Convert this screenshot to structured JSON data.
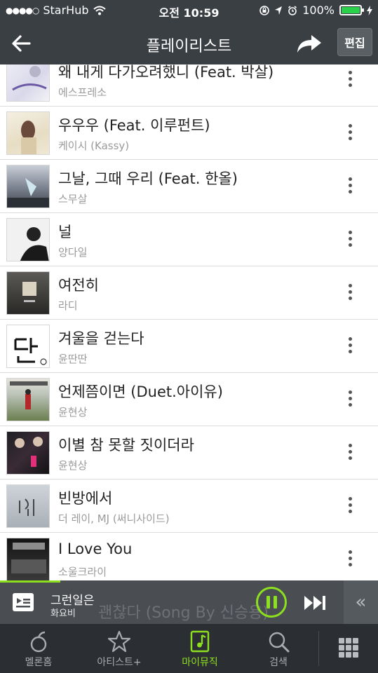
{
  "status": {
    "carrier": "StarHub",
    "time": "오전 10:59",
    "battery_text": "100%"
  },
  "nav": {
    "title": "플레이리스트",
    "edit_label": "편집"
  },
  "playlist": [
    {
      "song": "왜 내게 다가오려했니 (Feat. 박살)",
      "artist": "에스프레소"
    },
    {
      "song": "우우우 (Feat. 이루펀트)",
      "artist": "케이시 (Kassy)"
    },
    {
      "song": "그날, 그때 우리 (Feat. 한올)",
      "artist": "스무살"
    },
    {
      "song": "널",
      "artist": "양다일"
    },
    {
      "song": "여전히",
      "artist": "라디"
    },
    {
      "song": "겨울을 걷는다",
      "artist": "윤딴딴"
    },
    {
      "song": "언제쯤이면 (Duet.아이유)",
      "artist": "윤현상"
    },
    {
      "song": "이별 참 못할 짓이더라",
      "artist": "윤현상"
    },
    {
      "song": "빈방에서",
      "artist": "더 레이, MJ (써니사이드)"
    },
    {
      "song": "I Love You",
      "artist": "소울크라이"
    }
  ],
  "player": {
    "title": "그런일은",
    "artist": "화요비",
    "ghost_text": "괜찮다 (Song By 신승용)",
    "progress": 0.16,
    "accent": "#8de01e"
  },
  "tabs": [
    {
      "label": "멜론홈",
      "icon": "melon-home-icon"
    },
    {
      "label": "아티스트+",
      "icon": "star-icon"
    },
    {
      "label": "마이뮤직",
      "icon": "music-note-icon",
      "active": true
    },
    {
      "label": "검색",
      "icon": "search-icon"
    }
  ]
}
